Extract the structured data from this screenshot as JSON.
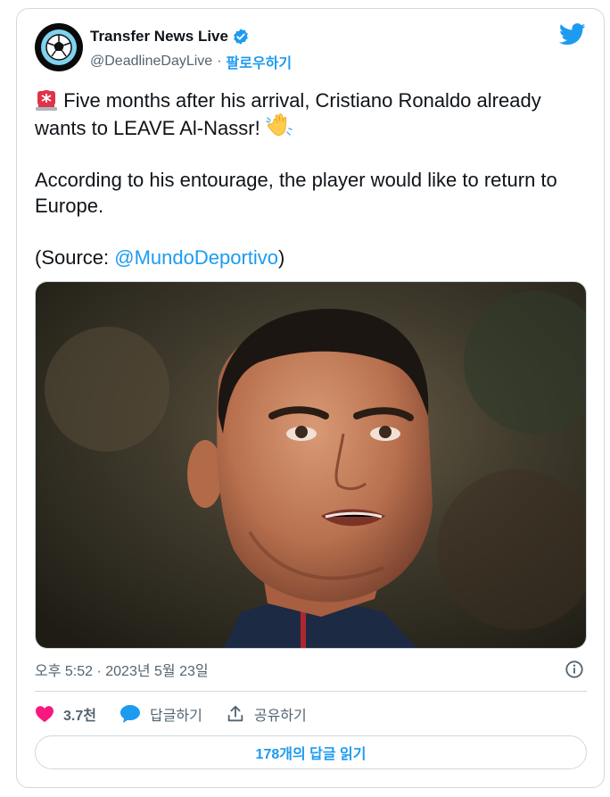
{
  "account": {
    "name": "Transfer News Live",
    "handle": "@DeadlineDayLive",
    "separator": "·",
    "follow_label": "팔로우하기"
  },
  "tweet": {
    "line1": "Five months after his arrival, Cristiano Ronaldo already wants to LEAVE Al-Nassr!",
    "line2": "According to his entourage, the player would like to return to Europe.",
    "source_prefix": "(Source: ",
    "source_link": "@MundoDeportivo",
    "source_suffix": ")"
  },
  "meta": {
    "timestamp": "오후 5:52 · 2023년 5월 23일"
  },
  "actions": {
    "likes": "3.7천",
    "reply_label": "답글하기",
    "share_label": "공유하기"
  },
  "replies_button": "178개의 답글 읽기",
  "colors": {
    "accent": "#1d9bf0",
    "like": "#f91880",
    "muted": "#536471"
  },
  "icons": {
    "verified": "verified-badge-icon",
    "twitter": "twitter-bird-icon",
    "siren": "siren-emoji",
    "wave": "waving-hand-emoji",
    "info": "info-icon",
    "heart": "heart-icon",
    "reply": "reply-bubble-icon",
    "share": "share-icon"
  }
}
